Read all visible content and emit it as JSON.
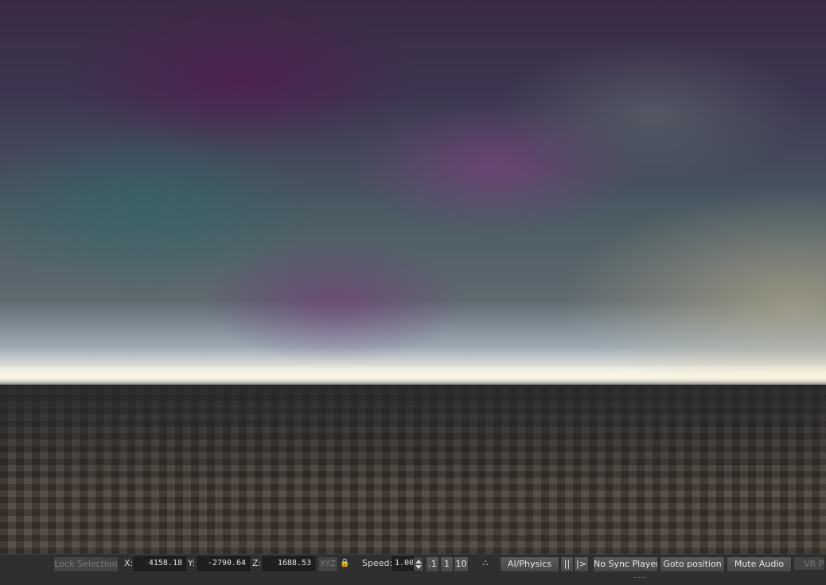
{
  "viewport": {
    "description_icon": "3d-viewport"
  },
  "toolbar": {
    "lock_selection": "Lock Selection",
    "x_label": "X:",
    "x_value": "4158.18",
    "y_label": "Y:",
    "y_value": "-2790.64",
    "z_label": "Z:",
    "z_value": "1688.53",
    "xyz_button": "XYZ",
    "lock_icon": "🔒",
    "speed_label": "Speed:",
    "speed_value": "1.00",
    "speed_preset_1": ".1",
    "speed_preset_2": "1",
    "speed_preset_3": "10",
    "network_icon": "⛬",
    "ai_physics": "AI/Physics",
    "pause": "||",
    "step": "|>",
    "no_sync_player": "No Sync Player",
    "goto_position": "Goto position",
    "mute_audio": "Mute Audio",
    "vr_preview": "VR Pre",
    "grip": "......"
  },
  "colors": {
    "toolbar_bg": "#2f2f2f",
    "button_bg": "#4f4f4f",
    "field_bg": "#1f1f1f",
    "text": "#e6e6e6"
  }
}
